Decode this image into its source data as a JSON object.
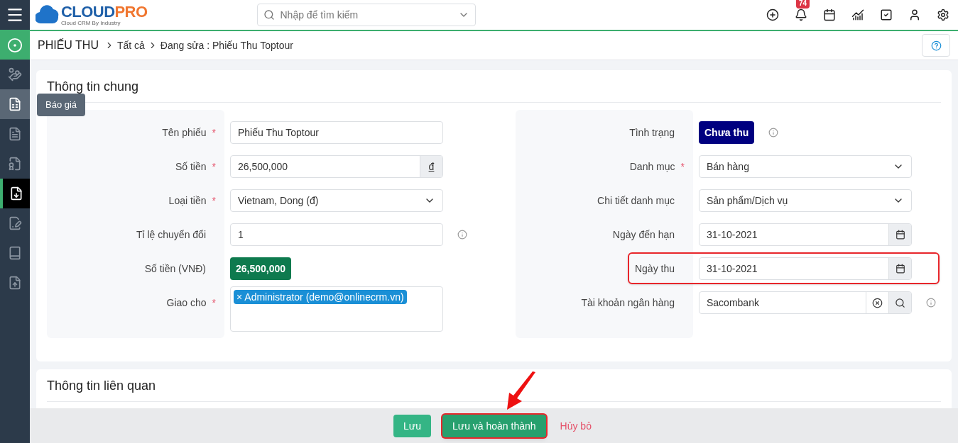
{
  "logo": {
    "part1": "CLOUD",
    "part2": "PRO",
    "tagline": "Cloud CRM By Industry"
  },
  "search": {
    "placeholder": "Nhập để tìm kiếm"
  },
  "notifications": {
    "count": "74"
  },
  "sidebar": {
    "items": [
      {
        "selected": false,
        "hovered": false
      },
      {
        "selected": false,
        "hovered": true,
        "tooltip": "Báo giá"
      },
      {
        "selected": false,
        "hovered": false
      },
      {
        "selected": false,
        "hovered": false
      },
      {
        "selected": true,
        "hovered": false
      },
      {
        "selected": false,
        "hovered": false
      },
      {
        "selected": false,
        "hovered": false
      },
      {
        "selected": false,
        "hovered": false
      }
    ]
  },
  "breadcrumb": [
    "PHIẾU THU",
    "Tất cả",
    "Đang sửa : Phiếu Thu Toptour"
  ],
  "sections": [
    {
      "title": "Thông tin chung",
      "left": [
        {
          "kind": "text",
          "label": "Tên phiếu",
          "required_mark": "*",
          "value": "Phiếu Thu Toptour"
        },
        {
          "kind": "addon",
          "label": "Số tiền",
          "required_mark": "*",
          "value": "26,500,000",
          "addon": "đ"
        },
        {
          "kind": "select",
          "label": "Loại tiền",
          "required_mark": "*",
          "value": "Vietnam, Dong (đ)"
        },
        {
          "kind": "text",
          "label": "Tỉ lệ chuyển đổi",
          "value": "1",
          "info": true
        },
        {
          "kind": "badge",
          "label": "Số tiền (VNĐ)",
          "value": "26,500,000",
          "color": "#0e7a4e"
        },
        {
          "kind": "tags",
          "label": "Giao cho",
          "required_mark": "*",
          "tags": [
            {
              "remove": "×",
              "text": "Administrator (demo@onlinecrm.vn)"
            }
          ]
        }
      ],
      "right": [
        {
          "kind": "badge",
          "label": "Tình trạng",
          "value": "Chưa thu",
          "color": "#000080",
          "info": true
        },
        {
          "kind": "select",
          "label": "Danh mục",
          "required_mark": "*",
          "value": "Bán hàng"
        },
        {
          "kind": "select",
          "label": "Chi tiết danh mục",
          "value": "Sản phẩm/Dịch vụ"
        },
        {
          "kind": "date",
          "label": "Ngày đến hạn",
          "value": "31-10-2021"
        },
        {
          "kind": "date",
          "label": "Ngày thu",
          "value": "31-10-2021",
          "highlighted": true
        },
        {
          "kind": "lookup",
          "label": "Tài khoản ngân hàng",
          "value": "Sacombank",
          "info": true
        }
      ]
    },
    {
      "title": "Thông tin liên quan"
    }
  ],
  "footer": {
    "buttons": [
      {
        "kind": "primary",
        "label": "Lưu",
        "highlighted": false
      },
      {
        "kind": "primary",
        "label": "Lưu và hoàn thành",
        "highlighted": true
      },
      {
        "kind": "link",
        "label": "Hủy bỏ"
      }
    ]
  }
}
